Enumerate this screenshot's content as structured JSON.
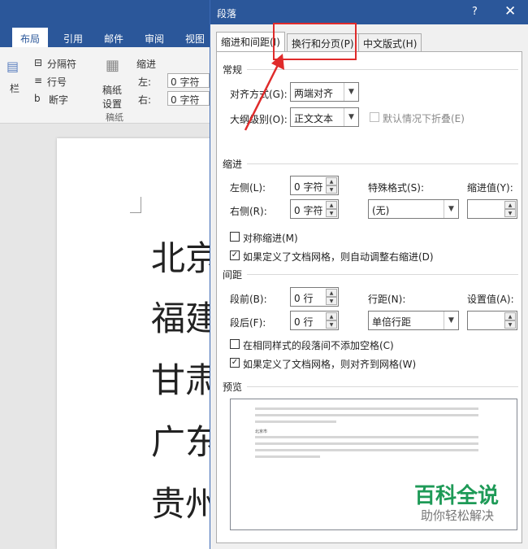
{
  "word": {
    "ribbon_tabs": [
      "布局",
      "引用",
      "邮件",
      "审阅",
      "视图"
    ],
    "ribbon_items": {
      "columns": "栏",
      "breaks": "分隔符",
      "line_numbers": "行号",
      "hyphenation": "断字",
      "manuscript": "稿纸设置",
      "manuscript_group": "稿纸",
      "indent_title": "缩进",
      "left": "左:",
      "right": "右:",
      "left_value": "0 字符",
      "right_value": "0 字符"
    },
    "document_chars": [
      "北京",
      "福建",
      "甘肃",
      "广东",
      "贵州"
    ]
  },
  "dialog": {
    "title": "段落",
    "help": "?",
    "close": "✕",
    "tabs": [
      "缩进和间距(I)",
      "换行和分页(P)",
      "中文版式(H)"
    ],
    "general": {
      "section": "常规",
      "alignment_label": "对齐方式(G):",
      "alignment_value": "两端对齐",
      "outline_label": "大纲级别(O):",
      "outline_value": "正文文本",
      "collapsed_label": "默认情况下折叠(E)"
    },
    "indent": {
      "section": "缩进",
      "left_label": "左侧(L):",
      "left_value": "0 字符",
      "right_label": "右侧(R):",
      "right_value": "0 字符",
      "special_label": "特殊格式(S):",
      "special_value": "(无)",
      "indent_by_label": "缩进值(Y):",
      "mirror_label": "对称缩进(M)",
      "auto_adjust_label": "如果定义了文档网格，则自动调整右缩进(D)"
    },
    "spacing": {
      "section": "间距",
      "before_label": "段前(B):",
      "before_value": "0 行",
      "after_label": "段后(F):",
      "after_value": "0 行",
      "line_spacing_label": "行距(N):",
      "line_spacing_value": "单倍行距",
      "at_label": "设置值(A):",
      "no_space_label": "在相同样式的段落间不添加空格(C)",
      "snap_grid_label": "如果定义了文档网格，则对齐到网格(W)"
    },
    "preview": {
      "section": "预览",
      "sample_text": "北京市",
      "watermark_title": "百科全说",
      "watermark_sub": "助你轻松解决"
    }
  },
  "colors": {
    "brand": "#2b579a",
    "highlight": "#e02b2b",
    "watermark": "#1e9a57"
  }
}
